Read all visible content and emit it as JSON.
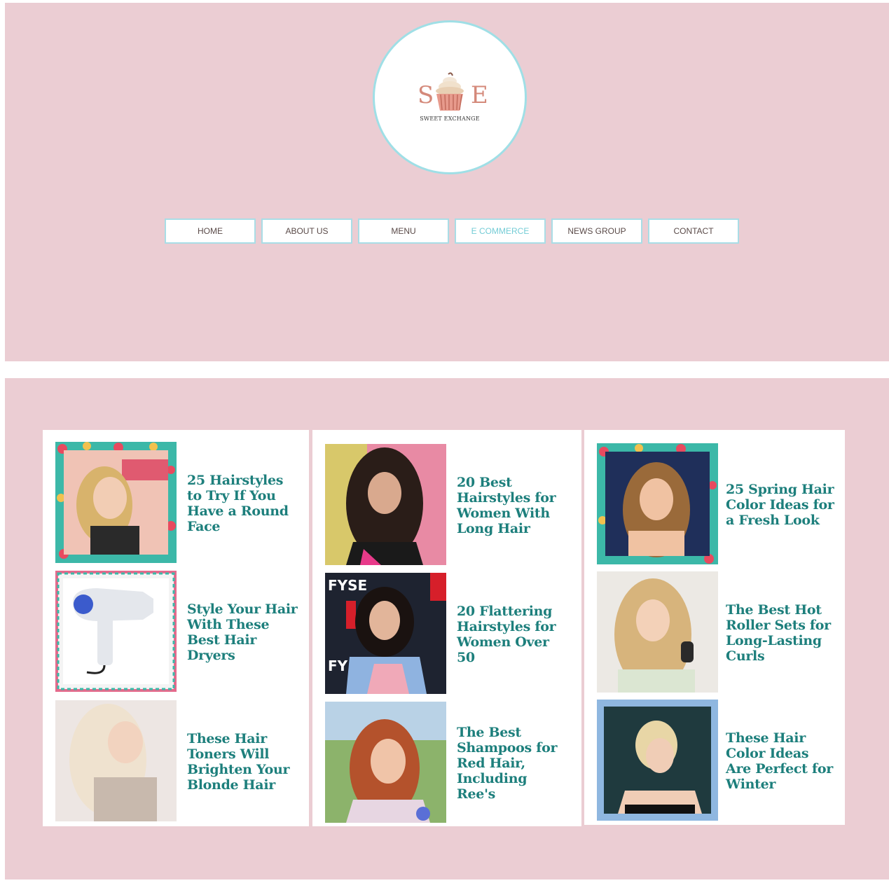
{
  "logo": {
    "letter_left": "S",
    "letter_right": "E",
    "tagline": "SWEET EXCHANGE"
  },
  "nav": {
    "items": [
      {
        "label": "HOME"
      },
      {
        "label": "ABOUT US"
      },
      {
        "label": "MENU"
      },
      {
        "label": "E COMMERCE",
        "active": true
      },
      {
        "label": "NEWS GROUP"
      },
      {
        "label": "CONTACT"
      }
    ]
  },
  "columns": [
    {
      "articles": [
        {
          "title": "25 Hairstyles to Try If You Have a Round Face"
        },
        {
          "title": "Style Your Hair With These Best Hair Dryers"
        },
        {
          "title": "These Hair Toners Will Brighten Your Blonde Hair"
        }
      ]
    },
    {
      "articles": [
        {
          "title": "20 Best Hairstyles for Women With Long Hair"
        },
        {
          "title": "20 Flattering Hairstyles for Women Over 50"
        },
        {
          "title": "The Best Shampoos for Red Hair, Including Ree's"
        }
      ]
    },
    {
      "articles": [
        {
          "title": "25 Spring Hair Color Ideas for a Fresh Look"
        },
        {
          "title": "The Best Hot Roller Sets for Long-Lasting Curls"
        },
        {
          "title": "These Hair Color Ideas Are Perfect for Winter"
        }
      ]
    }
  ],
  "colors": {
    "page_background": "#ebcdd3",
    "accent_border": "#9fdfe6",
    "title_text": "#1d7f7c",
    "logo_letters": "#d4897a"
  }
}
